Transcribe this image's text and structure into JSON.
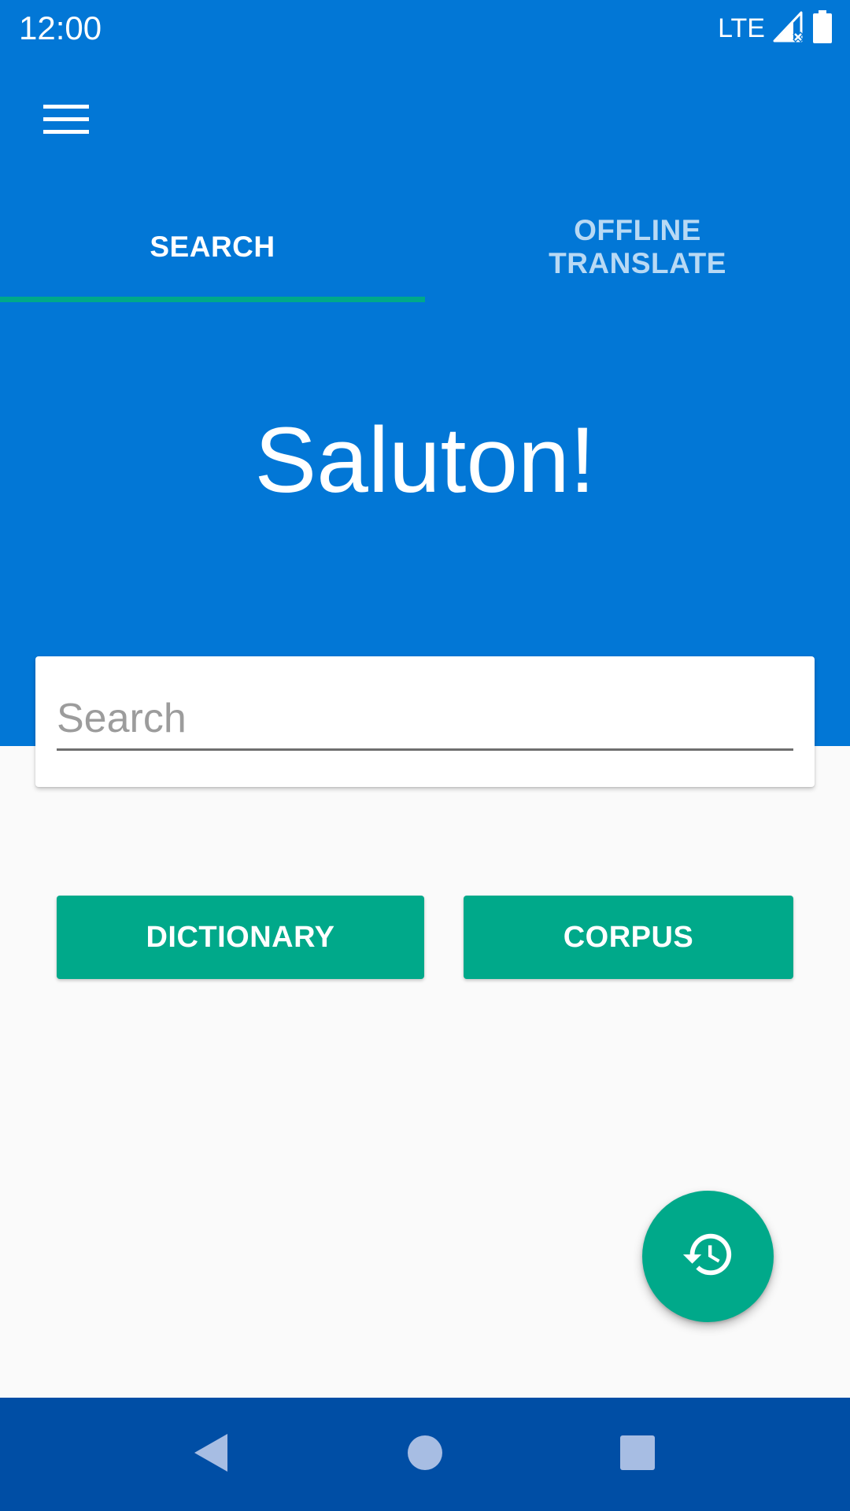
{
  "status_bar": {
    "time": "12:00",
    "network": "LTE",
    "icons": [
      "signal-no-data-icon",
      "battery-full-icon"
    ]
  },
  "app_bar": {
    "menu_icon": "hamburger-menu-icon"
  },
  "tabs": [
    {
      "label": "SEARCH",
      "active": true
    },
    {
      "label": "OFFLINE TRANSLATE",
      "active": false
    }
  ],
  "hero": {
    "greeting": "Saluton!"
  },
  "search": {
    "placeholder": "Search",
    "value": ""
  },
  "actions": {
    "dictionary_label": "DICTIONARY",
    "corpus_label": "CORPUS"
  },
  "fab": {
    "icon": "history-icon"
  },
  "nav_bar": {
    "icons": [
      "back-icon",
      "home-icon",
      "recent-apps-icon"
    ]
  },
  "colors": {
    "primary": "#0277d6",
    "accent": "#00a98a",
    "nav_bar": "#004ea5",
    "background": "#fafafa"
  }
}
